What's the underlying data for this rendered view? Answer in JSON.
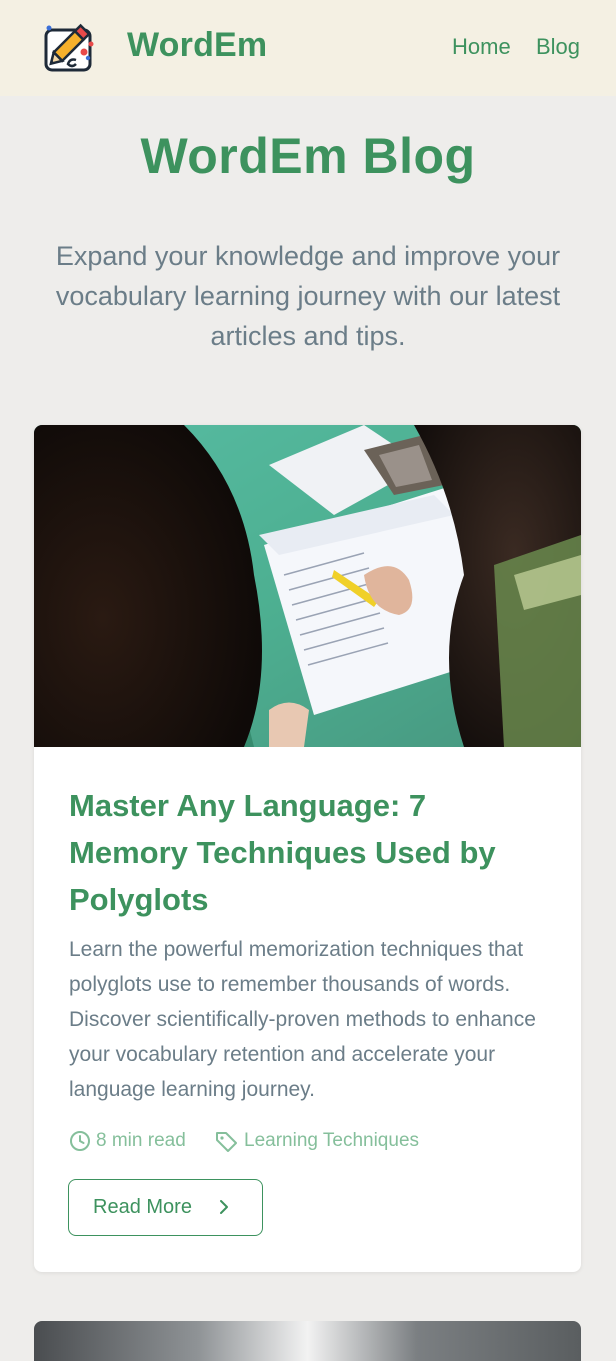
{
  "header": {
    "brand": "WordEm",
    "logo_icon": "pencil-icon",
    "nav": [
      {
        "label": "Home"
      },
      {
        "label": "Blog"
      }
    ]
  },
  "main": {
    "title": "WordEm Blog",
    "intro": "Expand your knowledge and improve your vocabulary learning journey with our latest articles and tips."
  },
  "posts": [
    {
      "image_icon": "article-photo",
      "title": "Master Any Language: 7 Memory Techniques Used by Polyglots",
      "excerpt": "Learn the powerful memorization techniques that polyglots use to remember thousands of words. Discover scientifically-proven methods to enhance your vocabulary retention and accelerate your language learning journey.",
      "read_time": "8 min read",
      "category": "Learning Techniques",
      "read_more": "Read More"
    }
  ],
  "colors": {
    "accent": "#3d925e",
    "header_bg": "#f4f0e3",
    "page_bg": "#eeedeb",
    "muted_text": "#6b7d88",
    "meta_text": "#85bf9b"
  }
}
